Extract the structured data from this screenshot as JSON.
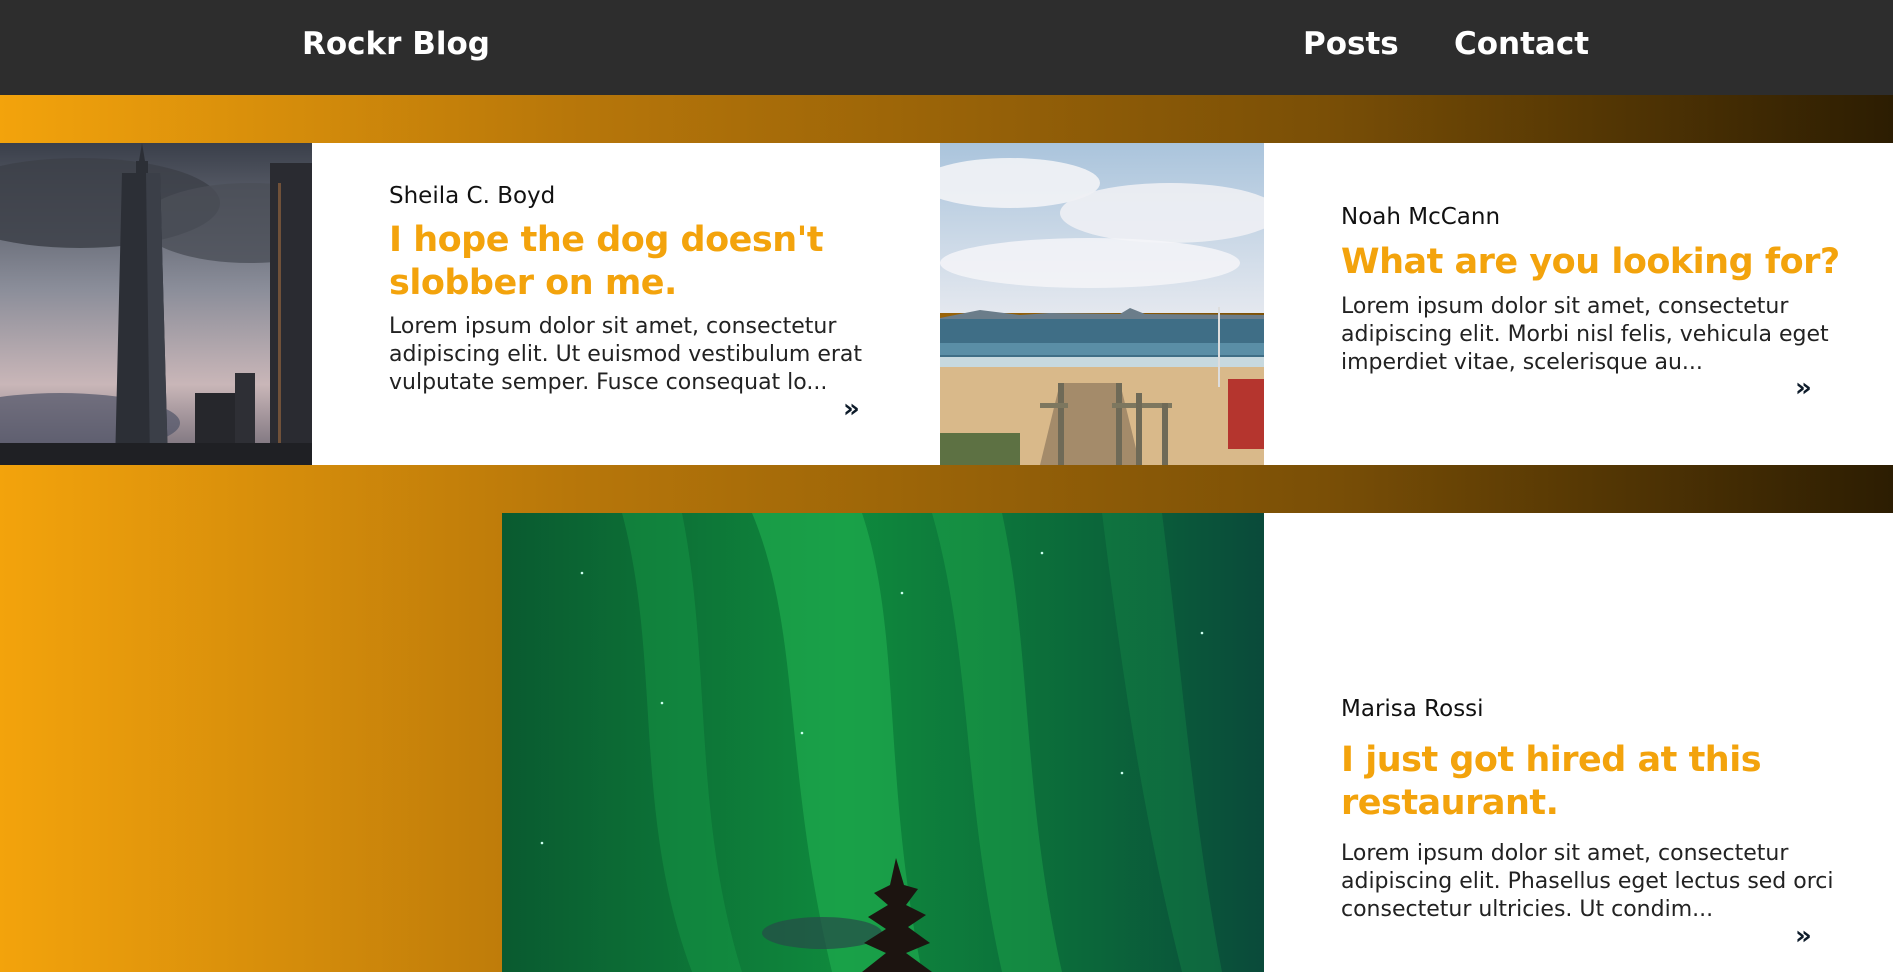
{
  "header": {
    "brand": "Rockr Blog",
    "nav": {
      "posts": "Posts",
      "contact": "Contact"
    }
  },
  "posts": [
    {
      "author": "Sheila C. Boyd",
      "title": "I hope the dog doesn't slobber on me.",
      "excerpt": "Lorem ipsum dolor sit amet, consectetur adipiscing elit. Ut euismod vestibulum erat vulputate semper. Fusce consequat lo...",
      "more_icon": "»"
    },
    {
      "author": "Noah McCann",
      "title": "What are you looking for?",
      "excerpt": "Lorem ipsum dolor sit amet, consectetur adipiscing elit. Morbi nisl felis, vehicula eget imperdiet vitae, scelerisque au...",
      "more_icon": "»"
    },
    {
      "author": "Marisa Rossi",
      "title": "I just got hired at this restaurant.",
      "excerpt": "Lorem ipsum dolor sit amet, consectetur adipiscing elit. Phasellus eget lectus sed orci consectetur ultricies. Ut condim...",
      "more_icon": "»"
    }
  ],
  "colors": {
    "accent": "#f3a30c",
    "navbar": "#2d2d2d",
    "gradient_start": "#f3a30c",
    "gradient_end": "#2c1d02"
  }
}
